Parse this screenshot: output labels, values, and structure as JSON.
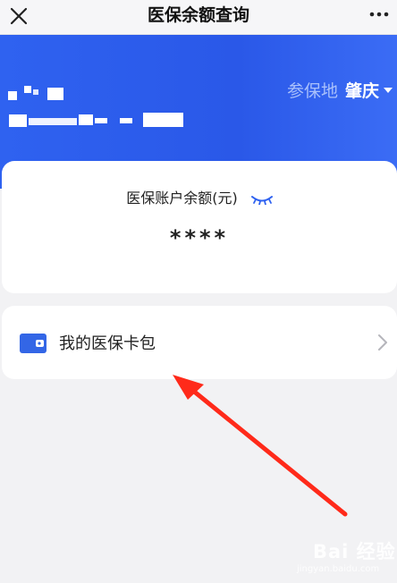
{
  "header": {
    "title": "医保余额查询",
    "close_icon": "close-icon",
    "more_icon": "more-dots-icon"
  },
  "banner": {
    "region_label": "参保地",
    "region_value": "肇庆",
    "dropdown_icon": "caret-down-icon",
    "colors": {
      "background": "#2f62f0",
      "label": "#a9c0fb"
    }
  },
  "balance_card": {
    "label": "医保账户余额(元)",
    "value": "****",
    "toggle_icon": "eye-closed-icon"
  },
  "wallet": {
    "label": "我的医保卡包",
    "icon": "wallet-icon",
    "chevron_icon": "chevron-right-icon",
    "colors": {
      "icon": "#3366e6"
    }
  },
  "annotation": {
    "arrow_color": "#ff2a1a"
  },
  "watermark": {
    "text": "Bai 经验",
    "url": "jingyan.baidu.com"
  }
}
